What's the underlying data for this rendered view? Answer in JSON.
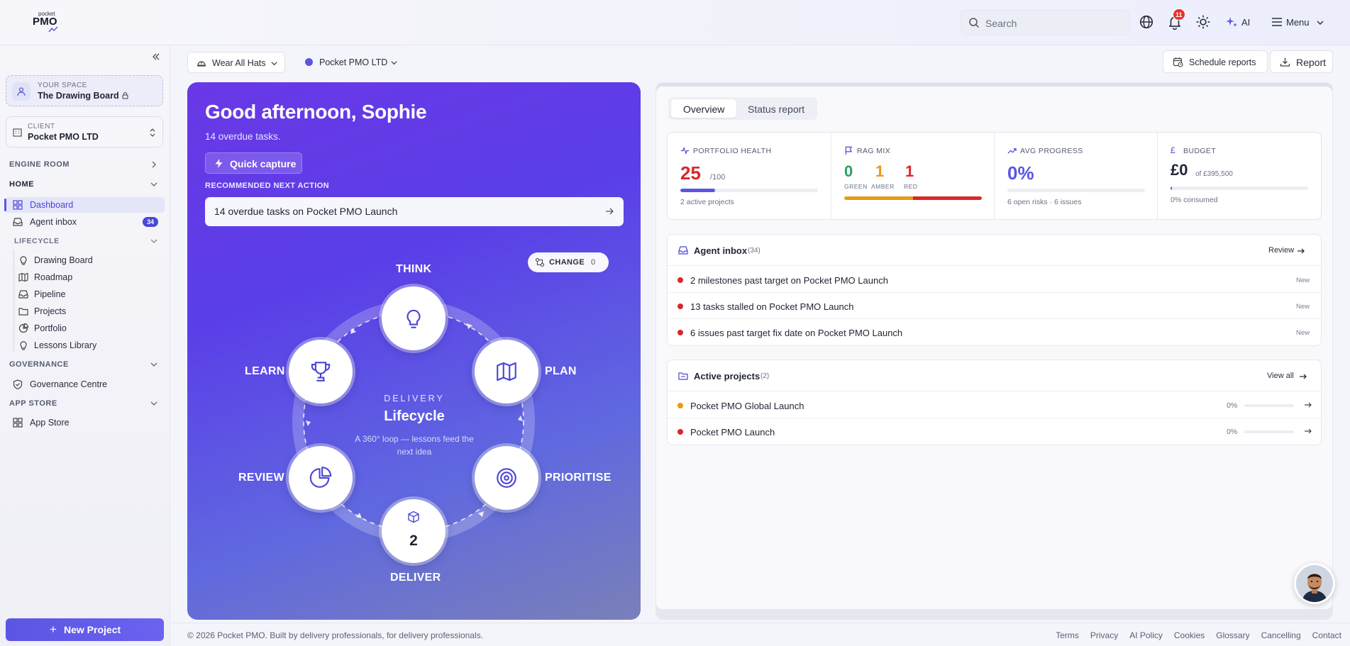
{
  "brand": {
    "logo_small": "pocket",
    "logo_big": "PMO"
  },
  "topbar": {
    "search_placeholder": "Search",
    "notification_count": "11",
    "ai_label": "AI",
    "menu_label": "Menu"
  },
  "sidebar": {
    "space_label": "YOUR SPACE",
    "space_value": "The Drawing Board",
    "client_label": "CLIENT",
    "client_value": "Pocket PMO LTD",
    "engine_room": "ENGINE ROOM",
    "home": "HOME",
    "home_items": [
      {
        "label": "Dashboard",
        "icon": "grid-icon"
      },
      {
        "label": "Agent inbox",
        "icon": "inbox-icon",
        "count": "34"
      }
    ],
    "lifecycle": "LIFECYCLE",
    "lifecycle_items": [
      {
        "label": "Drawing Board",
        "icon": "bulb-icon"
      },
      {
        "label": "Roadmap",
        "icon": "map-icon"
      },
      {
        "label": "Pipeline",
        "icon": "inbox-icon"
      },
      {
        "label": "Projects",
        "icon": "folder-icon"
      },
      {
        "label": "Portfolio",
        "icon": "pie-icon"
      },
      {
        "label": "Lessons Library",
        "icon": "bulb-icon"
      }
    ],
    "governance": "GOVERNANCE",
    "governance_items": [
      {
        "label": "Governance Centre",
        "icon": "shield-icon"
      }
    ],
    "app_store": "APP STORE",
    "app_store_items": [
      {
        "label": "App Store",
        "icon": "grid-icon"
      }
    ],
    "new_project": "New Project"
  },
  "header": {
    "role_filter": "Wear All Hats",
    "client_filter": "Pocket PMO LTD",
    "schedule_reports": "Schedule reports",
    "report": "Report"
  },
  "hero": {
    "greeting": "Good afternoon, Sophie",
    "overdue": "14 overdue tasks.",
    "quick_capture": "Quick capture",
    "recommended_label": "RECOMMENDED NEXT ACTION",
    "recommended_text": "14 overdue tasks on Pocket PMO Launch",
    "change_label": "CHANGE",
    "change_count": "0",
    "lifecycle": {
      "kicker": "DELIVERY",
      "title": "Lifecycle",
      "desc": "A 360° loop — lessons feed the next idea",
      "stages": {
        "think": "THINK",
        "plan": "PLAN",
        "prioritise": "PRIORITISE",
        "deliver": "DELIVER",
        "review": "REVIEW",
        "learn": "LEARN"
      },
      "deliver_count": "2"
    }
  },
  "tabs": [
    "Overview",
    "Status report"
  ],
  "kpis": {
    "health": {
      "label": "PORTFOLIO HEALTH",
      "value": "25",
      "max": "/100",
      "progress": 0.25,
      "sub": "2 active projects",
      "color": "#d8282a"
    },
    "rag": {
      "label": "RAG MIX",
      "green": {
        "value": "0",
        "label": "GREEN",
        "color": "#2e9e63"
      },
      "amber": {
        "value": "1",
        "label": "AMBER",
        "color": "#e69a18"
      },
      "red": {
        "value": "1",
        "label": "RED",
        "color": "#d8282a"
      }
    },
    "progress": {
      "label": "AVG PROGRESS",
      "value": "0%",
      "progress": 0,
      "sub": "6 open risks · 6 issues"
    },
    "budget": {
      "label": "BUDGET",
      "value": "£0",
      "of": "of £395,500",
      "sub": "0% consumed"
    }
  },
  "agent_inbox": {
    "title": "Agent inbox",
    "count": "(34)",
    "action": "Review",
    "items": [
      {
        "text": "2 milestones past target on Pocket PMO Launch",
        "tag": "New"
      },
      {
        "text": "13 tasks stalled on Pocket PMO Launch",
        "tag": "New"
      },
      {
        "text": "6 issues past target fix date on Pocket PMO Launch",
        "tag": "New"
      }
    ]
  },
  "active_projects": {
    "title": "Active projects",
    "count": "(2)",
    "action": "View all",
    "items": [
      {
        "name": "Pocket PMO Global Launch",
        "pct": "0%",
        "status_color": "#e69a18"
      },
      {
        "name": "Pocket PMO Launch",
        "pct": "0%",
        "status_color": "#d8282a"
      }
    ]
  },
  "footer": {
    "copyright": "© 2026 Pocket PMO. Built by delivery professionals, for delivery professionals.",
    "links": [
      "Terms",
      "Privacy",
      "AI Policy",
      "Cookies",
      "Glossary",
      "Cancelling",
      "Contact"
    ]
  }
}
